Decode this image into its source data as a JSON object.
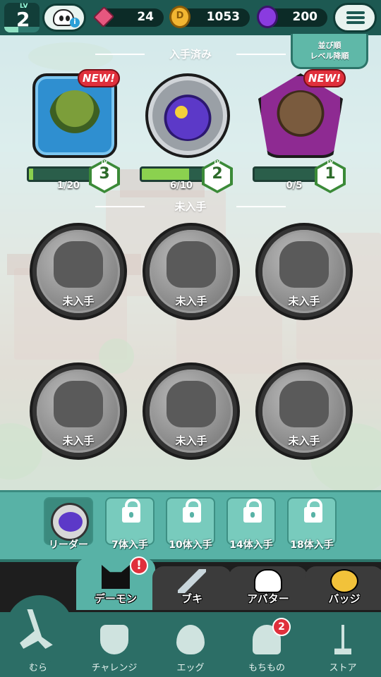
{
  "header": {
    "level_label": "LV",
    "level": "2",
    "resources": [
      {
        "name": "gem",
        "value": "24",
        "icon": "gem-icon"
      },
      {
        "name": "coin",
        "value": "1053",
        "icon": "coin-icon"
      },
      {
        "name": "orb",
        "value": "200",
        "icon": "orb-icon"
      }
    ],
    "coin_symbol": "D"
  },
  "sort_button": {
    "line1": "並び順",
    "line2": "レベル降順"
  },
  "obtained_title": "入手済み",
  "unobtained_title": "未入手",
  "obtained": [
    {
      "new": "NEW!",
      "progress_text": "1/20",
      "progress": 0.05,
      "level_label": "LV",
      "level": "3",
      "frame": "square"
    },
    {
      "new": "",
      "progress_text": "6/10",
      "progress": 0.6,
      "level_label": "LV",
      "level": "2",
      "frame": "circle"
    },
    {
      "new": "NEW!",
      "progress_text": "0/5",
      "progress": 0.0,
      "level_label": "LV",
      "level": "1",
      "frame": "pentagon"
    }
  ],
  "locked_label": "未入手",
  "leader": {
    "label": "リーダー",
    "slots": [
      "7体入手",
      "10体入手",
      "14体入手",
      "18体入手"
    ]
  },
  "category_tabs": [
    {
      "label": "デーモン",
      "icon": "cat-demon-icon",
      "alert": "!"
    },
    {
      "label": "ブキ",
      "icon": "sword-icon"
    },
    {
      "label": "アバター",
      "icon": "ghost-icon"
    },
    {
      "label": "バッジ",
      "icon": "badge-icon"
    }
  ],
  "bottom_nav": [
    {
      "label": "むら",
      "icon": "village-icon"
    },
    {
      "label": "チャレンジ",
      "icon": "challenge-icon"
    },
    {
      "label": "エッグ",
      "icon": "egg-icon"
    },
    {
      "label": "もちもの",
      "icon": "items-icon",
      "badge": "2"
    },
    {
      "label": "ストア",
      "icon": "store-icon"
    }
  ],
  "colors": {
    "header": "#1d5952",
    "accent": "#58b2a6",
    "new_badge": "#e0303c",
    "progress": "#8bd14f"
  }
}
